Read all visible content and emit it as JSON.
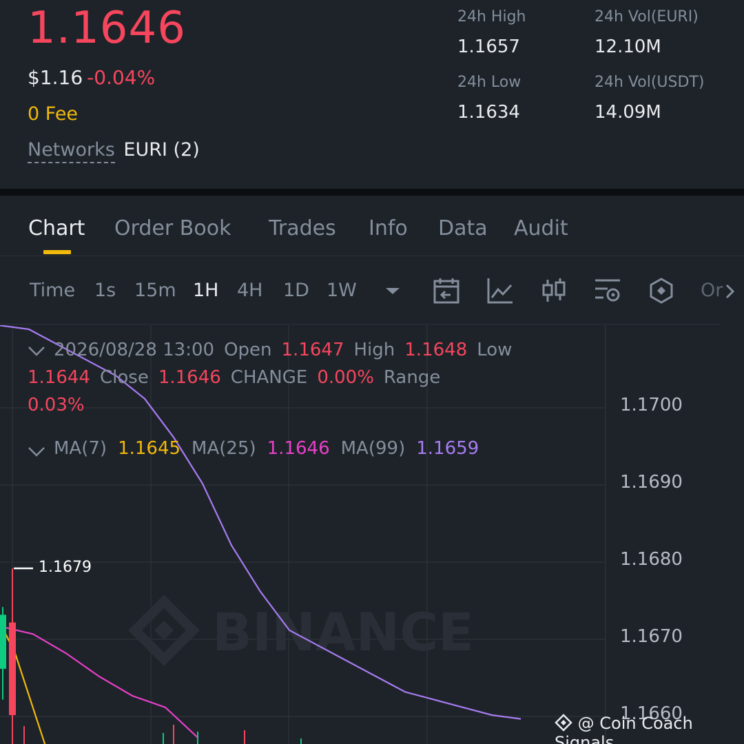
{
  "header": {
    "price": "1.1646",
    "fiat": "$1.16",
    "change": "-0.04%",
    "fee": "0 Fee",
    "networks_label": "Networks",
    "networks_value": "EURI (2)",
    "stats": {
      "high_label": "24h High",
      "high_value": "1.1657",
      "low_label": "24h Low",
      "low_value": "1.1634",
      "vol_euri_label": "24h Vol(EURI)",
      "vol_euri_value": "12.10M",
      "vol_usdt_label": "24h Vol(USDT)",
      "vol_usdt_value": "14.09M"
    }
  },
  "tabs": [
    "Chart",
    "Order Book",
    "Trades",
    "Info",
    "Data",
    "Audit"
  ],
  "active_tab": "Chart",
  "timeframes": [
    "Time",
    "1s",
    "15m",
    "1H",
    "4H",
    "1D",
    "1W"
  ],
  "active_timeframe": "1H",
  "toolbar_icons": [
    "calendar-icon",
    "line-chart-icon",
    "candles-icon",
    "indicator-settings-icon",
    "hexagon-icon"
  ],
  "toolbar_more": "Or",
  "ohlc": {
    "datetime": "2026/08/28 13:00",
    "open_label": "Open",
    "open": "1.1647",
    "high_label": "High",
    "high": "1.1648",
    "low_label": "Low",
    "low": "1.1644",
    "close_label": "Close",
    "close": "1.1646",
    "change_label": "CHANGE",
    "change": "0.00%",
    "range_label": "Range",
    "range": "0.03%"
  },
  "ma": {
    "ma7_label": "MA(7)",
    "ma7": "1.1645",
    "ma25_label": "MA(25)",
    "ma25": "1.1646",
    "ma99_label": "MA(99)",
    "ma99": "1.1659"
  },
  "chart_data": {
    "type": "line",
    "y_ticks": [
      "1.1700",
      "1.1690",
      "1.1680",
      "1.1670",
      "1.1660"
    ],
    "ylim": [
      1.1656,
      1.1713
    ],
    "peak_label": "1.1679",
    "watermark": "BINANCE",
    "series": [
      {
        "name": "MA(99)",
        "color": "#a77cf2",
        "y": [
          1.17105,
          1.171,
          1.1708,
          1.1706,
          1.1704,
          1.1701,
          1.1696,
          1.169,
          1.1682,
          1.1676,
          1.1671,
          1.1669,
          1.1667,
          1.1665,
          1.1663,
          1.1662,
          1.1661,
          1.166,
          1.16595
        ]
      },
      {
        "name": "MA(25)",
        "color": "#e840c9",
        "y": [
          1.16715,
          1.16705,
          1.1668,
          1.1665,
          1.16625,
          1.1661,
          1.1657
        ]
      },
      {
        "name": "MA(7)",
        "color": "#f0b90b",
        "y": [
          1.1672,
          1.1668,
          1.1662,
          1.1656
        ]
      }
    ],
    "candles": [
      {
        "color": "green",
        "open": 1.1666,
        "close": 1.1673,
        "high": 1.1674,
        "low": 1.1662
      },
      {
        "color": "red",
        "open": 1.1672,
        "close": 1.166,
        "high": 1.1679,
        "low": 1.1656
      }
    ]
  },
  "watermark_text": "@ Coin Coach Signals",
  "colors": {
    "up": "#0ecb81",
    "down": "#f6465d",
    "accent": "#f0b90b",
    "bg": "#1e2329"
  }
}
